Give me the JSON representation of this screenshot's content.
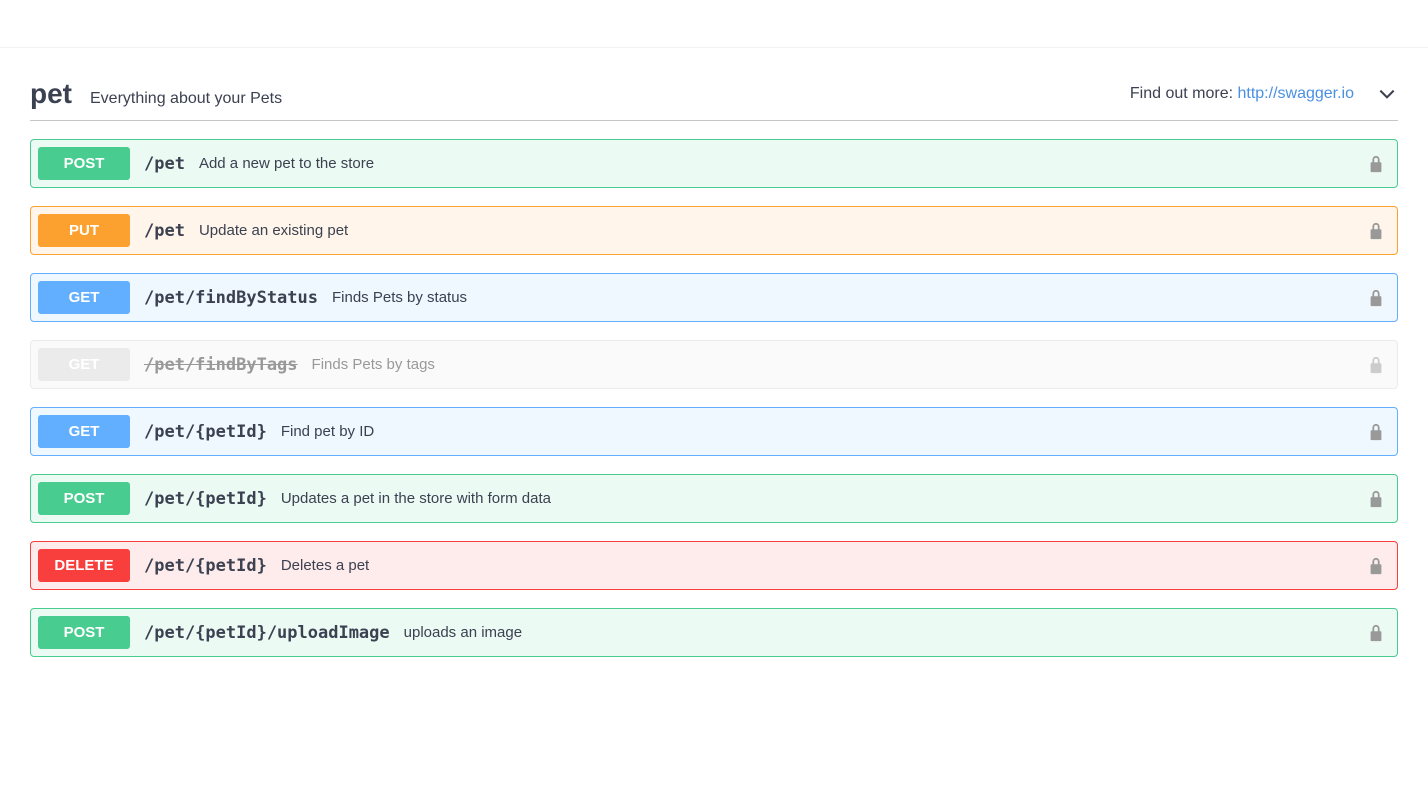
{
  "tag": {
    "name": "pet",
    "description": "Everything about your Pets",
    "external_label": "Find out more: ",
    "external_url_text": "http://swagger.io"
  },
  "operations": [
    {
      "method": "POST",
      "method_class": "post",
      "path": "/pet",
      "summary": "Add a new pet to the store",
      "deprecated": false
    },
    {
      "method": "PUT",
      "method_class": "put",
      "path": "/pet",
      "summary": "Update an existing pet",
      "deprecated": false
    },
    {
      "method": "GET",
      "method_class": "get",
      "path": "/pet/findByStatus",
      "summary": "Finds Pets by status",
      "deprecated": false
    },
    {
      "method": "GET",
      "method_class": "get",
      "path": "/pet/findByTags",
      "summary": "Finds Pets by tags",
      "deprecated": true
    },
    {
      "method": "GET",
      "method_class": "get",
      "path": "/pet/{petId}",
      "summary": "Find pet by ID",
      "deprecated": false
    },
    {
      "method": "POST",
      "method_class": "post",
      "path": "/pet/{petId}",
      "summary": "Updates a pet in the store with form data",
      "deprecated": false
    },
    {
      "method": "DELETE",
      "method_class": "delete",
      "path": "/pet/{petId}",
      "summary": "Deletes a pet",
      "deprecated": false
    },
    {
      "method": "POST",
      "method_class": "post",
      "path": "/pet/{petId}/uploadImage",
      "summary": "uploads an image",
      "deprecated": false
    }
  ]
}
